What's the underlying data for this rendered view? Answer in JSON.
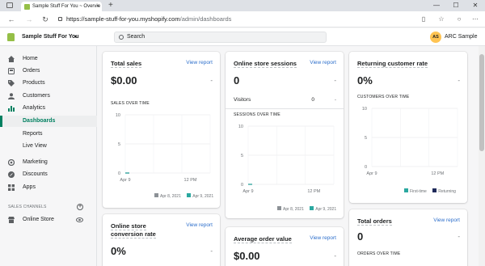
{
  "browser": {
    "tab_title": "Sample Stuff For You ~ Overvie",
    "tab_close": "×",
    "new_tab": "+",
    "url_host": "https://sample-stuff-for-you.myshopify.com",
    "url_path": "/admin/dashboards",
    "back": "←",
    "forward": "→",
    "reload": "↻",
    "minimize": "—",
    "maximize": "☐",
    "close": "✕"
  },
  "topbar": {
    "store_name": "Sample Stuff For You",
    "caret": "▾",
    "search_placeholder": "Search",
    "avatar_initials": "AS",
    "user_name": "ARC Sample"
  },
  "sidebar": {
    "items": [
      {
        "label": "Home",
        "icon": "home-icon"
      },
      {
        "label": "Orders",
        "icon": "orders-icon"
      },
      {
        "label": "Products",
        "icon": "tag-icon"
      },
      {
        "label": "Customers",
        "icon": "person-icon"
      },
      {
        "label": "Analytics",
        "icon": "bar-chart-icon"
      },
      {
        "label": "Dashboards",
        "sub": true,
        "active": true
      },
      {
        "label": "Reports",
        "sub": true
      },
      {
        "label": "Live View",
        "sub": true
      },
      {
        "label": "Marketing",
        "icon": "marketing-icon"
      },
      {
        "label": "Discounts",
        "icon": "discount-icon"
      },
      {
        "label": "Apps",
        "icon": "apps-icon"
      }
    ],
    "sales_channels_title": "SALES CHANNELS",
    "online_store_label": "Online Store"
  },
  "cards": {
    "total_sales": {
      "title": "Total sales",
      "link": "View report",
      "value": "$0.00",
      "dash": "-",
      "over_time": "SALES OVER TIME",
      "legend": [
        "Apr 8, 2021",
        "Apr 9, 2021"
      ]
    },
    "online_sessions": {
      "title": "Online store sessions",
      "link": "View report",
      "value": "0",
      "dash": "-",
      "visitors_label": "Visitors",
      "visitors_value": "0",
      "visitors_dash": "-",
      "over_time": "SESSIONS OVER TIME",
      "legend": [
        "Apr 8, 2021",
        "Apr 9, 2021"
      ]
    },
    "returning_rate": {
      "title": "Returning customer rate",
      "value": "0%",
      "dash": "-",
      "over_time": "CUSTOMERS OVER TIME",
      "legend": [
        "First-time",
        "Returning"
      ]
    },
    "conversion_rate": {
      "title_line1": "Online store",
      "title_line2": "conversion rate",
      "link": "View report",
      "value": "0%",
      "dash": "-"
    },
    "avg_order_value": {
      "title": "Average order value",
      "link": "View report",
      "value": "$0.00",
      "dash": "-"
    },
    "total_orders": {
      "title": "Total orders",
      "link": "View report",
      "value": "0",
      "dash": "-",
      "over_time": "ORDERS OVER TIME"
    }
  },
  "colors": {
    "current_series": "#2ba8a0",
    "previous_series": "#8c9196",
    "returning_series": "#1f2a5a",
    "accent_green": "#008060",
    "link_blue": "#2c6ecb"
  },
  "chart_data": [
    {
      "type": "line",
      "x": [
        "Apr 9",
        "12 PM"
      ],
      "ylim": [
        0,
        10
      ],
      "yticks": [
        "10",
        "5",
        "0"
      ],
      "series": [
        {
          "name": "Apr 8, 2021",
          "values": [
            0,
            0
          ]
        },
        {
          "name": "Apr 9, 2021",
          "values": [
            0,
            0
          ]
        }
      ]
    },
    {
      "type": "line",
      "x": [
        "Apr 9",
        "12 PM"
      ],
      "ylim": [
        0,
        10
      ],
      "yticks": [
        "10",
        "5",
        "0"
      ],
      "series": [
        {
          "name": "Apr 8, 2021",
          "values": [
            0,
            0
          ]
        },
        {
          "name": "Apr 9, 2021",
          "values": [
            0,
            0
          ]
        }
      ]
    },
    {
      "type": "bar",
      "x": [
        "Apr 9",
        "12 PM"
      ],
      "ylim": [
        0,
        10
      ],
      "yticks": [
        "10",
        "5",
        "0"
      ],
      "series": [
        {
          "name": "First-time",
          "values": [
            0,
            0
          ]
        },
        {
          "name": "Returning",
          "values": [
            0,
            0
          ]
        }
      ]
    }
  ]
}
